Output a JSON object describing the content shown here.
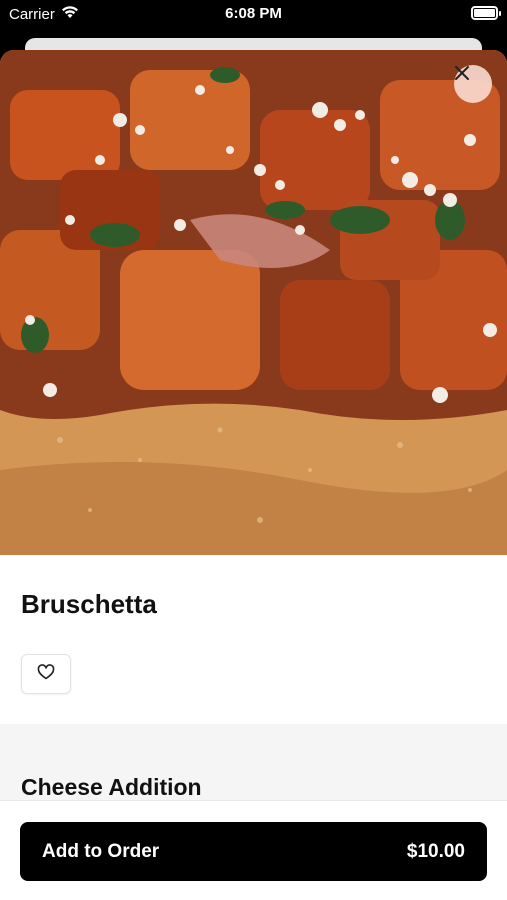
{
  "status_bar": {
    "carrier": "Carrier",
    "time": "6:08 PM",
    "wifi_icon": "wifi-icon",
    "battery_icon": "battery-icon"
  },
  "item": {
    "image": "bruschetta-photo",
    "title": "Bruschetta",
    "favorite_icon": "heart-icon",
    "close_icon": "close-icon"
  },
  "options": {
    "section_title": "Cheese Addition"
  },
  "footer": {
    "add_label": "Add to Order",
    "price": "$10.00"
  },
  "colors": {
    "button_bg": "#000000",
    "close_bg": "#fadcd2",
    "section_bg": "#f5f5f5"
  }
}
